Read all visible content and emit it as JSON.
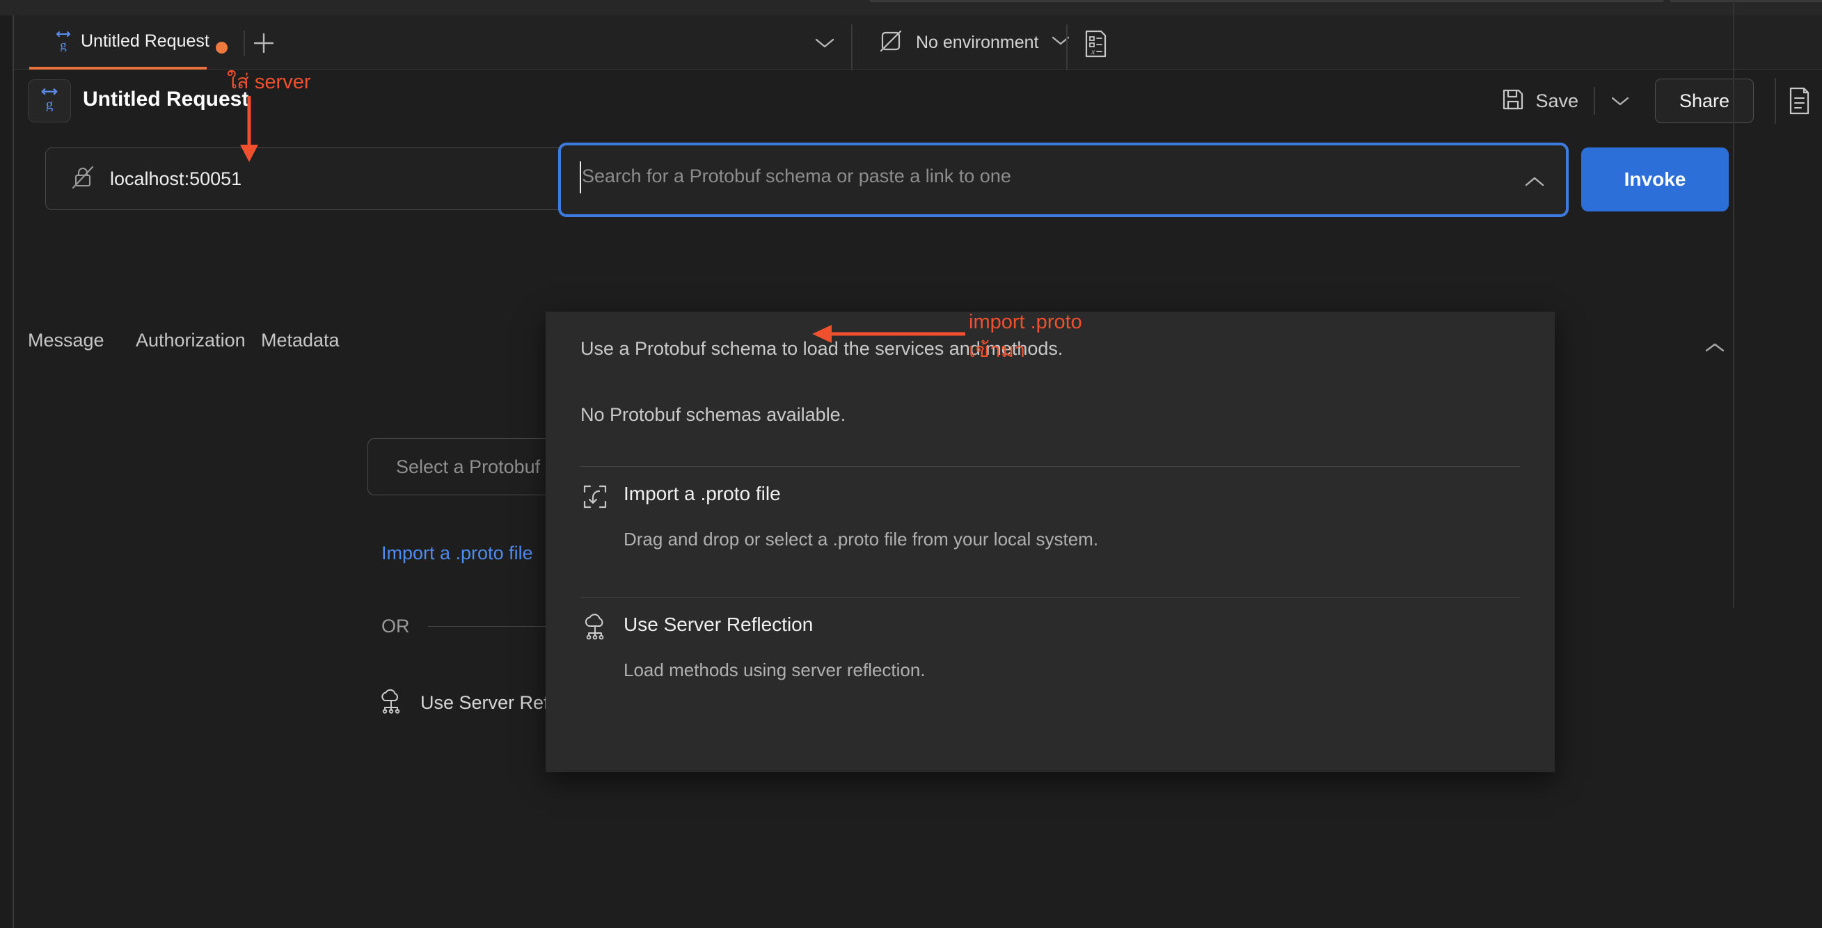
{
  "window": {
    "app": "Postman gRPC Request",
    "background_color": "#1e1e1e"
  },
  "tabbar": {
    "tab_label": "Untitled Request",
    "tab_icon": "grpc-icon",
    "unsaved_dot": "●",
    "new_tab_icon": "plus-icon",
    "overflow_icon": "chevron-down-icon",
    "environment": {
      "icon": "no-environment-icon",
      "label": "No environment",
      "caret_icon": "chevron-down-icon"
    },
    "env_vars_icon": "environment-variables-icon"
  },
  "request_header": {
    "icon": "grpc-icon",
    "title": "Untitled Request",
    "save_label": "Save",
    "save_icon": "floppy-disk-icon",
    "save_caret_icon": "chevron-down-icon",
    "share_label": "Share",
    "docs_icon": "documentation-icon"
  },
  "url_row": {
    "security_icon": "insecure-lock-icon",
    "server_url": "localhost:50051",
    "schema_placeholder": "Search for a Protobuf schema or paste a link to one",
    "schema_value": "",
    "schema_chevron_icon": "chevron-up-icon",
    "invoke_label": "Invoke"
  },
  "tabs": {
    "items": [
      {
        "label": "Message",
        "active": false
      },
      {
        "label": "Authorization",
        "active": false
      },
      {
        "label": "Metadata",
        "active": false
      }
    ],
    "collapse_icon": "chevron-up-icon"
  },
  "body_background": {
    "select_proto_label": "Select a Protobuf file",
    "import_link_label": "Import a .proto file",
    "or_label": "OR",
    "use_reflection_label": "Use Server Reflection",
    "reflection_icon": "server-reflection-icon"
  },
  "dropdown": {
    "hint": "Use a Protobuf schema to load the services and methods.",
    "empty_state": "No Protobuf schemas available.",
    "items": [
      {
        "icon": "import-file-icon",
        "title": "Import a .proto file",
        "description": "Drag and drop or select a .proto file from your local system."
      },
      {
        "icon": "server-reflection-icon",
        "title": "Use Server Reflection",
        "description": "Load methods using server reflection."
      }
    ]
  },
  "annotations": {
    "color": "#F0502E",
    "items": [
      {
        "text": "ใส่ server",
        "arrow": "down-arrow"
      },
      {
        "line1": "import .proto",
        "line2": "เข้ามา",
        "arrow": "left-arrow"
      }
    ]
  },
  "colors": {
    "accent_orange": "#E8713C",
    "accent_blue": "#2D6FD8",
    "focus_blue": "#3D7BE0",
    "link_blue": "#4E8BF0",
    "annotation_red": "#F0502E",
    "panel_bg": "#2b2b2b",
    "app_bg": "#1e1e1e"
  }
}
